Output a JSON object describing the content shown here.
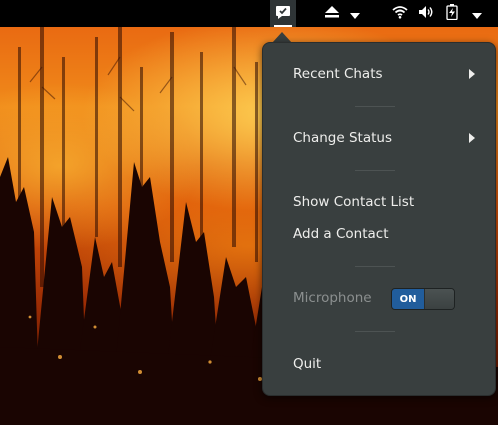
{
  "wallpaper": {
    "description_icon": "forest-fire-wallpaper"
  },
  "topbar": {
    "tray_icons": [
      {
        "name": "empathy-chat-icon"
      },
      {
        "name": "eject-icon"
      },
      {
        "name": "network-wireless-icon"
      },
      {
        "name": "volume-icon"
      },
      {
        "name": "battery-charging-icon"
      }
    ]
  },
  "menu": {
    "recent_chats": "Recent Chats",
    "change_status": "Change Status",
    "show_contact_list": "Show Contact List",
    "add_contact": "Add a Contact",
    "microphone": "Microphone",
    "microphone_toggle": "ON",
    "quit": "Quit"
  },
  "colors": {
    "panel": "#000000",
    "menu_bg": "#393f3f",
    "toggle_on": "#215d9c",
    "menu_text": "#eeeeec",
    "disabled_text": "#8b8f8f"
  }
}
